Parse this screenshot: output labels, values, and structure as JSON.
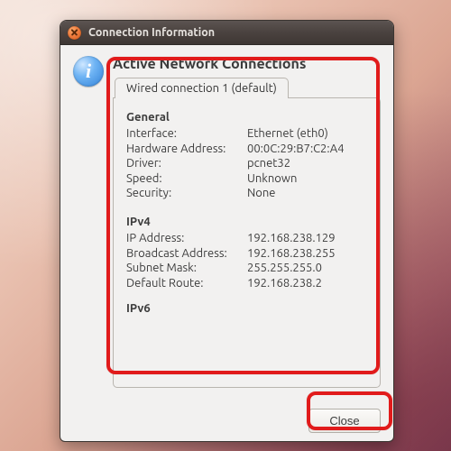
{
  "window": {
    "title": "Connection Information"
  },
  "heading": "Active Network Connections",
  "info_icon_glyph": "i",
  "tab": {
    "label": "Wired connection 1 (default)"
  },
  "sections": {
    "general": {
      "title": "General",
      "interface": {
        "k": "Interface:",
        "v": "Ethernet (eth0)"
      },
      "hardware_address": {
        "k": "Hardware Address:",
        "v": "00:0C:29:B7:C2:A4"
      },
      "driver": {
        "k": "Driver:",
        "v": "pcnet32"
      },
      "speed": {
        "k": "Speed:",
        "v": "Unknown"
      },
      "security": {
        "k": "Security:",
        "v": "None"
      }
    },
    "ipv4": {
      "title": "IPv4",
      "ip": {
        "k": "IP Address:",
        "v": "192.168.238.129"
      },
      "broadcast": {
        "k": "Broadcast Address:",
        "v": "192.168.238.255"
      },
      "subnet": {
        "k": "Subnet Mask:",
        "v": "255.255.255.0"
      },
      "route": {
        "k": "Default Route:",
        "v": "192.168.238.2"
      }
    },
    "ipv6": {
      "title": "IPv6"
    }
  },
  "buttons": {
    "close": "Close"
  }
}
